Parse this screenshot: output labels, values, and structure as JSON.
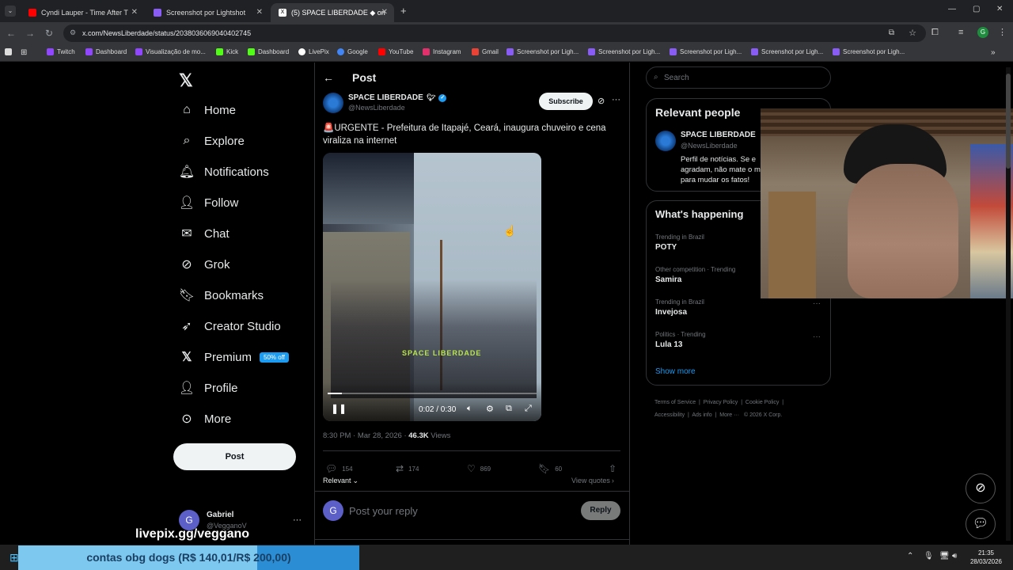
{
  "browser": {
    "tabs": [
      {
        "title": "Cyndi Lauper - Time After T",
        "active": false
      },
      {
        "title": "Screenshot por Lightshot",
        "active": false
      },
      {
        "title": "(5) SPACE LIBERDADE ◆ on",
        "active": true
      }
    ],
    "url": "x.com/NewsLiberdade/status/2038036069040402745",
    "bookmarks": [
      "Twitch",
      "Dashboard",
      "Visualização de mo...",
      "Kick",
      "Dashboard",
      "LivePix",
      "Google",
      "YouTube",
      "Instagram",
      "Gmail",
      "Screenshot por Ligh...",
      "Screenshot por Ligh...",
      "Screenshot por Ligh...",
      "Screenshot por Ligh...",
      "Screenshot por Ligh..."
    ]
  },
  "nav": {
    "items": [
      "Home",
      "Explore",
      "Notifications",
      "Follow",
      "Chat",
      "Grok",
      "Bookmarks",
      "Creator Studio",
      "Premium",
      "Profile",
      "More"
    ],
    "premium_badge": "50% off",
    "post_button": "Post",
    "account_name": "Gabriel",
    "account_handle": "@VegganoV"
  },
  "post": {
    "header": "Post",
    "author_name": "SPACE LIBERDADE",
    "author_handle": "@NewsLiberdade",
    "subscribe": "Subscribe",
    "text": "🚨URGENTE - Prefeitura de Itapajé, Ceará, inaugura chuveiro e cena viraliza na internet",
    "video_time": "0:02 / 0:30",
    "video_progress": 0.067,
    "watermark": "SPACE LIBERDADE",
    "timestamp": "8:30 PM · Mar 28, 2026 · ",
    "views_count": "46.3K",
    "views_label": " Views",
    "replies": "154",
    "reposts": "174",
    "likes": "869",
    "bookmarks": "60",
    "sort": "Relevant",
    "view_quotes": "View quotes",
    "reply_placeholder": "Post your reply",
    "reply_button": "Reply"
  },
  "sidebar": {
    "search_placeholder": "Search",
    "relevant_title": "Relevant people",
    "relevant_name": "SPACE LIBERDADE",
    "relevant_handle": "@NewsLiberdade",
    "relevant_bio": "Perfil de notícias. Se e agradam, não mate o m para mudar os fatos!",
    "happening_title": "What's happening",
    "trends": [
      {
        "category": "Trending in Brazil",
        "name": "POTY"
      },
      {
        "category": "Other competition · Trending",
        "name": "Samira"
      },
      {
        "category": "Trending in Brazil",
        "name": "Invejosa"
      },
      {
        "category": "Politics · Trending",
        "name": "Lula 13"
      }
    ],
    "show_more": "Show more",
    "footer": [
      "Terms of Service",
      "Privacy Policy",
      "Cookie Policy",
      "Accessibility",
      "Ads info",
      "More ···",
      "© 2026 X Corp."
    ]
  },
  "overlay": {
    "livepix": "livepix.gg/veggano",
    "goal_text": "contas obg dogs (R$ 140,01/R$ 200,00)",
    "goal_progress": 0.7
  },
  "taskbar": {
    "time": "21:35",
    "date": "28/03/2026"
  },
  "colors": {
    "accent": "#1d9bf0",
    "background": "#000000",
    "border": "#2f3336"
  }
}
